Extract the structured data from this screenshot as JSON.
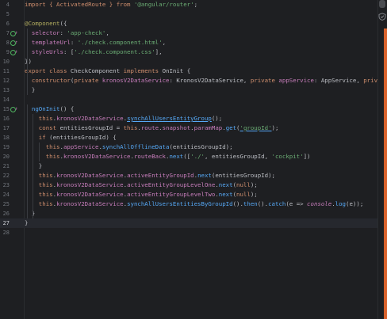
{
  "editor": {
    "lines": [
      {
        "num": "4",
        "icon": "",
        "tokens": [
          {
            "t": "import { ActivatedRoute } from ",
            "c": "kw"
          },
          {
            "t": "'@angular/router'",
            "c": "str"
          },
          {
            "t": ";",
            "c": ""
          }
        ]
      },
      {
        "num": "5",
        "icon": "",
        "tokens": []
      },
      {
        "num": "6",
        "icon": "",
        "tokens": [
          {
            "t": "@Component",
            "c": "dec"
          },
          {
            "t": "({",
            "c": ""
          }
        ]
      },
      {
        "num": "7",
        "icon": "gutter",
        "tokens": [
          {
            "t": "  selector",
            "c": "prop"
          },
          {
            "t": ": ",
            "c": ""
          },
          {
            "t": "'app-check'",
            "c": "str"
          },
          {
            "t": ",",
            "c": ""
          }
        ]
      },
      {
        "num": "8",
        "icon": "gutter",
        "tokens": [
          {
            "t": "  templateUrl",
            "c": "prop"
          },
          {
            "t": ": ",
            "c": ""
          },
          {
            "t": "'./check.component.html'",
            "c": "str"
          },
          {
            "t": ",",
            "c": ""
          }
        ]
      },
      {
        "num": "9",
        "icon": "gutter",
        "tokens": [
          {
            "t": "  styleUrls",
            "c": "prop"
          },
          {
            "t": ": [",
            "c": ""
          },
          {
            "t": "'./check.component.css'",
            "c": "str"
          },
          {
            "t": "],",
            "c": ""
          }
        ]
      },
      {
        "num": "10",
        "icon": "",
        "tokens": [
          {
            "t": "})",
            "c": ""
          }
        ]
      },
      {
        "num": "11",
        "icon": "",
        "tokens": [
          {
            "t": "export class ",
            "c": "kw"
          },
          {
            "t": "CheckComponent ",
            "c": ""
          },
          {
            "t": "implements ",
            "c": "kw"
          },
          {
            "t": "OnInit {",
            "c": ""
          }
        ]
      },
      {
        "num": "12",
        "icon": "",
        "tokens": [
          {
            "t": "  constructor",
            "c": "kw"
          },
          {
            "t": "(",
            "c": ""
          },
          {
            "t": "private ",
            "c": "kw"
          },
          {
            "t": "kronosV2DataService",
            "c": "prop"
          },
          {
            "t": ": KronosV2DataService, ",
            "c": ""
          },
          {
            "t": "private ",
            "c": "kw"
          },
          {
            "t": "appService",
            "c": "prop"
          },
          {
            "t": ": AppService, ",
            "c": ""
          },
          {
            "t": "private r",
            "c": "kw"
          }
        ]
      },
      {
        "num": "13",
        "icon": "",
        "tokens": [
          {
            "t": "  }",
            "c": ""
          }
        ]
      },
      {
        "num": "14",
        "icon": "",
        "tokens": []
      },
      {
        "num": "15",
        "icon": "gutter",
        "tokens": [
          {
            "t": "  ngOnInit",
            "c": "fn"
          },
          {
            "t": "() {",
            "c": ""
          }
        ]
      },
      {
        "num": "16",
        "icon": "",
        "tokens": [
          {
            "t": "    this",
            "c": "kw"
          },
          {
            "t": ".",
            "c": ""
          },
          {
            "t": "kronosV2DataService",
            "c": "prop"
          },
          {
            "t": ".",
            "c": ""
          },
          {
            "t": "synchAllUsersEntityGroup",
            "c": "fn ul"
          },
          {
            "t": "();",
            "c": ""
          }
        ]
      },
      {
        "num": "17",
        "icon": "",
        "tokens": [
          {
            "t": "    const ",
            "c": "kw"
          },
          {
            "t": "entitiesGroupId = ",
            "c": ""
          },
          {
            "t": "this",
            "c": "kw"
          },
          {
            "t": ".",
            "c": ""
          },
          {
            "t": "route",
            "c": "prop"
          },
          {
            "t": ".",
            "c": ""
          },
          {
            "t": "snapshot",
            "c": "prop"
          },
          {
            "t": ".",
            "c": ""
          },
          {
            "t": "paramMap",
            "c": "prop"
          },
          {
            "t": ".",
            "c": ""
          },
          {
            "t": "get",
            "c": "fn"
          },
          {
            "t": "(",
            "c": ""
          },
          {
            "t": "'groupId'",
            "c": "str ul"
          },
          {
            "t": ");",
            "c": ""
          }
        ]
      },
      {
        "num": "18",
        "icon": "",
        "tokens": [
          {
            "t": "    if ",
            "c": "kw"
          },
          {
            "t": "(entitiesGroupId) {",
            "c": ""
          }
        ]
      },
      {
        "num": "19",
        "icon": "",
        "tokens": [
          {
            "t": "      this",
            "c": "kw"
          },
          {
            "t": ".",
            "c": ""
          },
          {
            "t": "appService",
            "c": "prop"
          },
          {
            "t": ".",
            "c": ""
          },
          {
            "t": "synchAllOfflineData",
            "c": "fn"
          },
          {
            "t": "(entitiesGroupId);",
            "c": ""
          }
        ]
      },
      {
        "num": "20",
        "icon": "",
        "tokens": [
          {
            "t": "      this",
            "c": "kw"
          },
          {
            "t": ".",
            "c": ""
          },
          {
            "t": "kronosV2DataService",
            "c": "prop"
          },
          {
            "t": ".",
            "c": ""
          },
          {
            "t": "routeBack",
            "c": "prop"
          },
          {
            "t": ".",
            "c": ""
          },
          {
            "t": "next",
            "c": "fn"
          },
          {
            "t": "([",
            "c": ""
          },
          {
            "t": "'./'",
            "c": "str"
          },
          {
            "t": ", entitiesGroupId, ",
            "c": ""
          },
          {
            "t": "'cockpit'",
            "c": "str"
          },
          {
            "t": "])",
            "c": ""
          }
        ]
      },
      {
        "num": "21",
        "icon": "",
        "tokens": [
          {
            "t": "    }",
            "c": ""
          }
        ]
      },
      {
        "num": "22",
        "icon": "",
        "tokens": [
          {
            "t": "    this",
            "c": "kw"
          },
          {
            "t": ".",
            "c": ""
          },
          {
            "t": "kronosV2DataService",
            "c": "prop"
          },
          {
            "t": ".",
            "c": ""
          },
          {
            "t": "activeEntityGroupId",
            "c": "prop"
          },
          {
            "t": ".",
            "c": ""
          },
          {
            "t": "next",
            "c": "fn"
          },
          {
            "t": "(entitiesGroupId);",
            "c": ""
          }
        ]
      },
      {
        "num": "23",
        "icon": "",
        "tokens": [
          {
            "t": "    this",
            "c": "kw"
          },
          {
            "t": ".",
            "c": ""
          },
          {
            "t": "kronosV2DataService",
            "c": "prop"
          },
          {
            "t": ".",
            "c": ""
          },
          {
            "t": "activeEntityGroupLevelOne",
            "c": "prop"
          },
          {
            "t": ".",
            "c": ""
          },
          {
            "t": "next",
            "c": "fn"
          },
          {
            "t": "(",
            "c": ""
          },
          {
            "t": "null",
            "c": "kw"
          },
          {
            "t": ");",
            "c": ""
          }
        ]
      },
      {
        "num": "24",
        "icon": "",
        "tokens": [
          {
            "t": "    this",
            "c": "kw"
          },
          {
            "t": ".",
            "c": ""
          },
          {
            "t": "kronosV2DataService",
            "c": "prop"
          },
          {
            "t": ".",
            "c": ""
          },
          {
            "t": "activeEntityGroupLevelTwo",
            "c": "prop"
          },
          {
            "t": ".",
            "c": ""
          },
          {
            "t": "next",
            "c": "fn"
          },
          {
            "t": "(",
            "c": ""
          },
          {
            "t": "null",
            "c": "kw"
          },
          {
            "t": ");",
            "c": ""
          }
        ]
      },
      {
        "num": "25",
        "icon": "",
        "tokens": [
          {
            "t": "    this",
            "c": "kw"
          },
          {
            "t": ".",
            "c": ""
          },
          {
            "t": "kronosV2DataService",
            "c": "prop"
          },
          {
            "t": ".",
            "c": ""
          },
          {
            "t": "synchAllUsersEntitiesByGroupId",
            "c": "fn"
          },
          {
            "t": "().",
            "c": ""
          },
          {
            "t": "then",
            "c": "fn"
          },
          {
            "t": "().",
            "c": ""
          },
          {
            "t": "catch",
            "c": "fn"
          },
          {
            "t": "(e => ",
            "c": ""
          },
          {
            "t": "console",
            "c": "prop it"
          },
          {
            "t": ".",
            "c": ""
          },
          {
            "t": "log",
            "c": "fn"
          },
          {
            "t": "(e));",
            "c": ""
          }
        ]
      },
      {
        "num": "26",
        "icon": "",
        "tokens": [
          {
            "t": "  }",
            "c": ""
          }
        ]
      },
      {
        "num": "27",
        "icon": "",
        "tokens": [
          {
            "t": "}",
            "c": ""
          }
        ]
      },
      {
        "num": "28",
        "icon": "",
        "tokens": []
      }
    ],
    "current_line": "27",
    "colors": {
      "background": "#1e1f22",
      "keyword": "#cf8e6d",
      "string": "#6aab73",
      "function": "#56a8f5",
      "property": "#c77dbb",
      "decorator": "#b3ae60",
      "error_stripe": "#d9622b"
    },
    "gutter_icon_name": "implementation-marker-icon",
    "right_strip_icon_name": "inspection-check-icon"
  }
}
